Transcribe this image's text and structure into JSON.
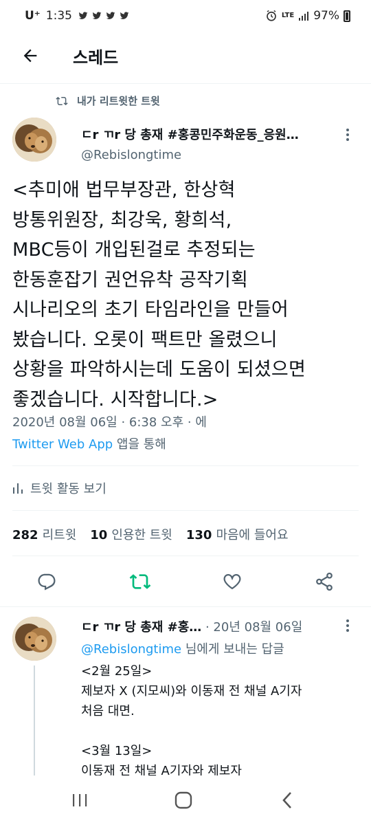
{
  "status_bar": {
    "carrier": "U⁺",
    "time": "1:35",
    "network": "LTE",
    "battery": "97%",
    "notification_icons": [
      "twitter-icon",
      "twitter-icon",
      "twitter-icon",
      "twitter-icon"
    ]
  },
  "header": {
    "title": "스레드"
  },
  "tweet": {
    "retweet_context": "내가 리트윗한 트윗",
    "author_name": "ㄷr ㄲr 당 총재 #홍콩민주화운동_응원…",
    "author_handle": "@Rebislongtime",
    "text": "<추미애 법무부장관, 한상혁\n방통위원장, 최강욱, 황희석,\nMBC등이 개입된걸로 추정되는\n한동훈잡기 권언유착 공작기획\n시나리오의 초기 타임라인을 만들어\n봤습니다. 오롯이 팩트만 올렸으니\n상황을 파악하시는데 도움이 되셨으면\n좋겠습니다. 시작합니다.>",
    "timestamp": "2020년 08월 06일 · 6:38 오후 · 에",
    "source_app": "Twitter Web App",
    "source_suffix": " 앱을 통해",
    "activity_label": "트윗 활동 보기",
    "stats": {
      "retweets": "282",
      "retweets_label": "리트윗",
      "quotes": "10",
      "quotes_label": "인용한 트윗",
      "likes": "130",
      "likes_label": "마음에 들어요"
    }
  },
  "reply": {
    "author_name": "ㄷr ㄲr 당 총재 #홍…",
    "date": " · 20년 08월 06일",
    "reply_to_handle": "@Rebislongtime",
    "reply_to_suffix": " 님에게 보내는 답글",
    "text": "<2월 25일>\n제보자 X (지모씨)와 이동재 전 채널 A기자\n처음 대면.\n\n<3월 13일>\n이동재 전 채널 A기자와 제보자"
  },
  "colors": {
    "accent": "#1d9bf0",
    "retweet_active": "#00ba7c",
    "secondary_text": "#536471",
    "primary_text": "#0f1419"
  }
}
